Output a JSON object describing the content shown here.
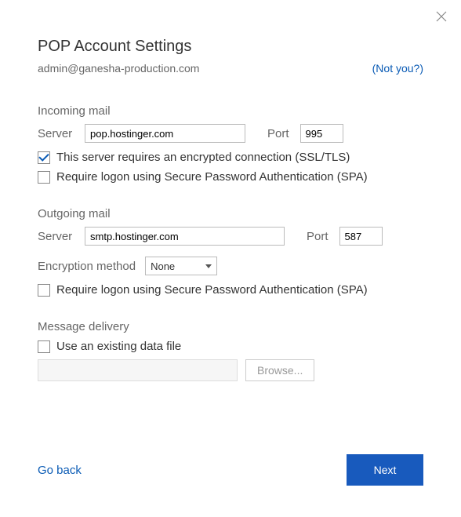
{
  "title": "POP Account Settings",
  "email": "admin@ganesha-production.com",
  "not_you": "(Not you?)",
  "incoming": {
    "heading": "Incoming mail",
    "server_label": "Server",
    "server_value": "pop.hostinger.com",
    "port_label": "Port",
    "port_value": "995",
    "ssl_label": "This server requires an encrypted connection (SSL/TLS)",
    "ssl_checked": true,
    "spa_label": "Require logon using Secure Password Authentication (SPA)",
    "spa_checked": false
  },
  "outgoing": {
    "heading": "Outgoing mail",
    "server_label": "Server",
    "server_value": "smtp.hostinger.com",
    "port_label": "Port",
    "port_value": "587",
    "enc_label": "Encryption method",
    "enc_value": "None",
    "spa_label": "Require logon using Secure Password Authentication (SPA)",
    "spa_checked": false
  },
  "delivery": {
    "heading": "Message delivery",
    "existing_label": "Use an existing data file",
    "existing_checked": false,
    "browse_label": "Browse..."
  },
  "footer": {
    "go_back": "Go back",
    "next": "Next"
  }
}
